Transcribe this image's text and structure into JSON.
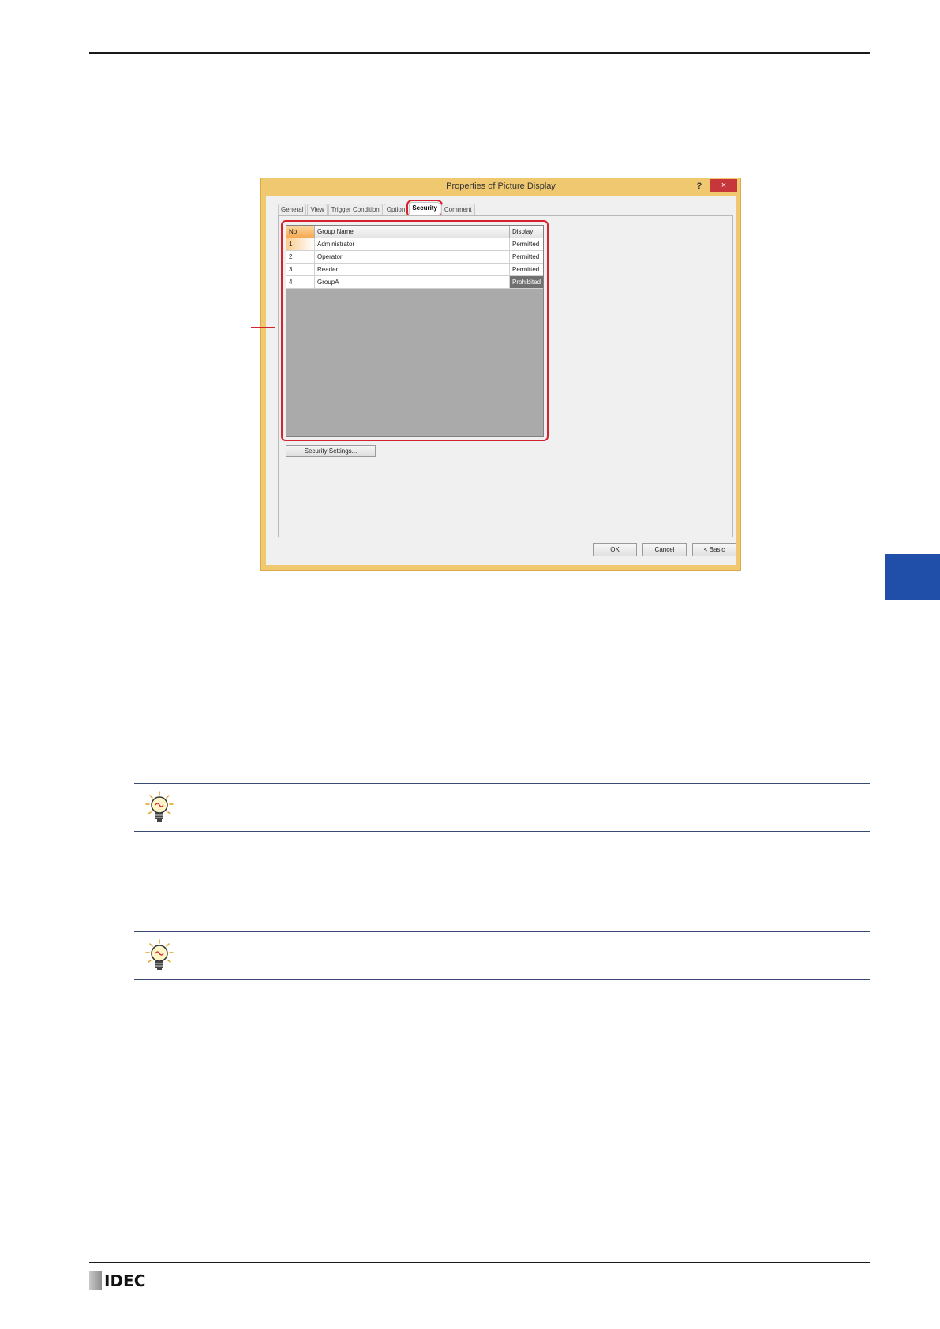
{
  "dialog": {
    "title": "Properties of Picture Display",
    "help_label": "?",
    "close_label": "×",
    "tabs": [
      {
        "label": "General"
      },
      {
        "label": "View"
      },
      {
        "label": "Trigger Condition"
      },
      {
        "label": "Option"
      },
      {
        "label": "Security"
      },
      {
        "label": "Comment"
      }
    ],
    "active_tab": "Security",
    "grid": {
      "columns": [
        "No.",
        "Group Name",
        "Display"
      ],
      "rows": [
        {
          "no": "1",
          "group": "Administrator",
          "display": "Permitted"
        },
        {
          "no": "2",
          "group": "Operator",
          "display": "Permitted"
        },
        {
          "no": "3",
          "group": "Reader",
          "display": "Permitted"
        },
        {
          "no": "4",
          "group": "GroupA",
          "display": "Prohibited"
        }
      ]
    },
    "security_settings_label": "Security Settings...",
    "ok_label": "OK",
    "cancel_label": "Cancel",
    "basic_label": "< Basic"
  },
  "footer": {
    "brand": "IDEC"
  },
  "colors": {
    "accent_red": "#d4232f",
    "side_tab_blue": "#1f4fa8",
    "dialog_frame": "#f0c870"
  }
}
